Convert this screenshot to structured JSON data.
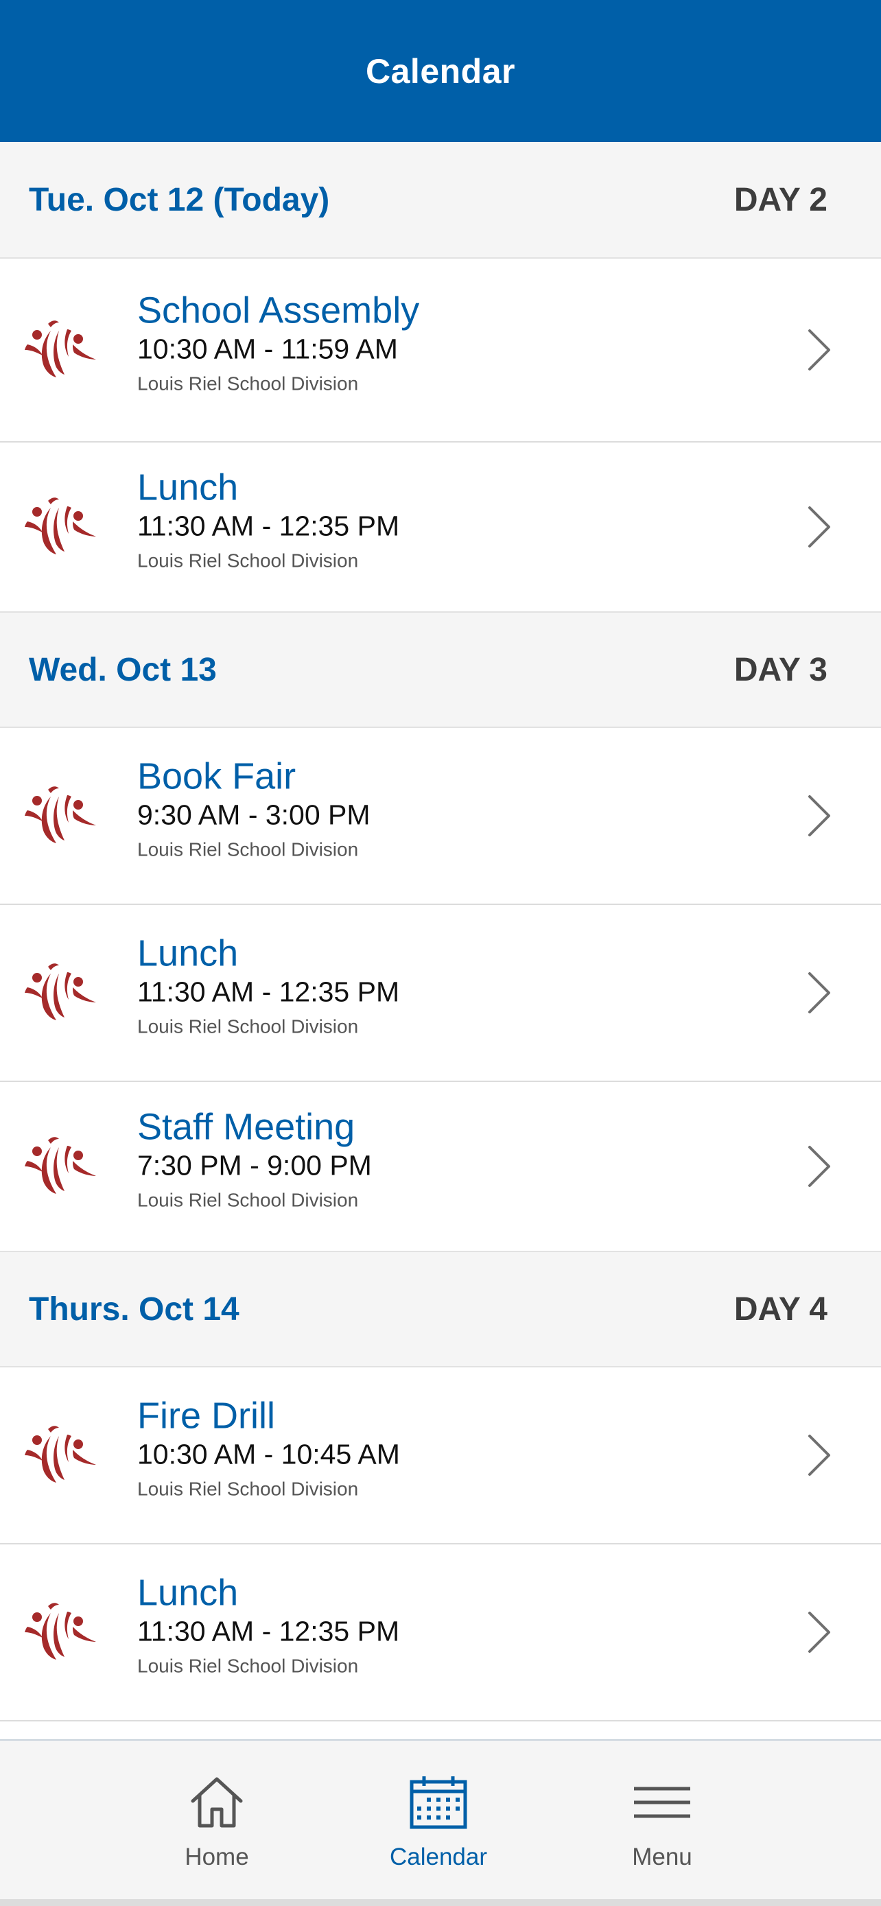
{
  "header": {
    "title": "Calendar"
  },
  "days": [
    {
      "date": "Tue. Oct 12 (Today)",
      "day_label": "DAY 2",
      "events": [
        {
          "title": "School Assembly",
          "time": "10:30 AM - 11:59 AM",
          "org": "Louis Riel School Division"
        },
        {
          "title": "Lunch",
          "time": "11:30 AM - 12:35 PM",
          "org": "Louis Riel School Division"
        }
      ]
    },
    {
      "date": "Wed. Oct 13",
      "day_label": "DAY 3",
      "events": [
        {
          "title": "Book Fair",
          "time": "9:30 AM - 3:00 PM",
          "org": "Louis Riel School Division"
        },
        {
          "title": "Lunch",
          "time": "11:30 AM - 12:35 PM",
          "org": "Louis Riel School Division"
        },
        {
          "title": "Staff Meeting",
          "time": "7:30 PM - 9:00 PM",
          "org": "Louis Riel School Division"
        }
      ]
    },
    {
      "date": "Thurs. Oct 14",
      "day_label": "DAY 4",
      "events": [
        {
          "title": "Fire Drill",
          "time": "10:30 AM - 10:45 AM",
          "org": "Louis Riel School Division"
        },
        {
          "title": "Lunch",
          "time": "11:30 AM - 12:35 PM",
          "org": "Louis Riel School Division"
        }
      ]
    }
  ],
  "tabbar": {
    "home_label": "Home",
    "calendar_label": "Calendar",
    "menu_label": "Menu",
    "active": "Calendar"
  },
  "colors": {
    "brand_blue": "#005fa8",
    "logo_red": "#a52a2a",
    "section_bg": "#f5f5f5"
  },
  "icons": {
    "event_logo": "louis-riel-logo",
    "row_chevron": "chevron-right-icon",
    "home_tab": "home-icon",
    "calendar_tab": "calendar-icon",
    "menu_tab": "hamburger-menu-icon"
  }
}
